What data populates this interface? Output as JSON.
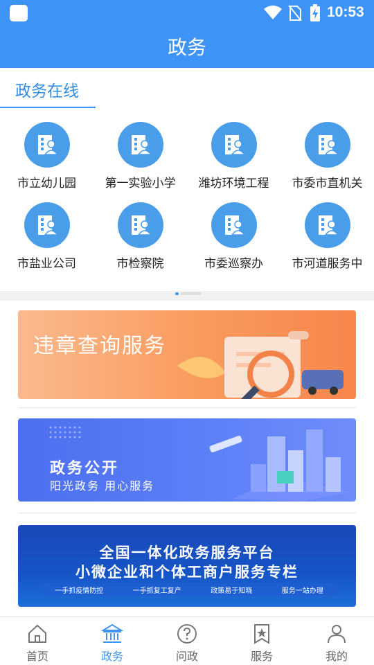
{
  "status_bar": {
    "time": "10:53"
  },
  "header": {
    "title": "政务"
  },
  "online_section": {
    "title": "政务在线",
    "orgs": [
      {
        "label": "市立幼儿园"
      },
      {
        "label": "第一实验小学"
      },
      {
        "label": "潍坊环境工程"
      },
      {
        "label": "市委市直机关"
      },
      {
        "label": "市盐业公司"
      },
      {
        "label": "市检察院"
      },
      {
        "label": "市委巡察办"
      },
      {
        "label": "市河道服务中"
      }
    ]
  },
  "banners": {
    "violation": {
      "title": "违章查询服务"
    },
    "open_gov": {
      "title": "政务公开",
      "subtitle": "阳光政务  用心服务"
    },
    "platform": {
      "line1": "全国一体化政务服务平台",
      "line2": "小微企业和个体工商户服务专栏",
      "tags": [
        "一手抓疫情防控",
        "一手抓复工复产",
        "政策易于知晓",
        "服务一站办理"
      ]
    }
  },
  "bottom_nav": {
    "items": [
      {
        "label": "首页",
        "icon": "home-icon"
      },
      {
        "label": "政务",
        "icon": "government-building-icon"
      },
      {
        "label": "问政",
        "icon": "question-icon"
      },
      {
        "label": "服务",
        "icon": "star-bookmark-icon"
      },
      {
        "label": "我的",
        "icon": "user-icon"
      }
    ],
    "active_index": 1
  },
  "colors": {
    "primary": "#3d94f6",
    "org_circle": "#4a9de8"
  }
}
